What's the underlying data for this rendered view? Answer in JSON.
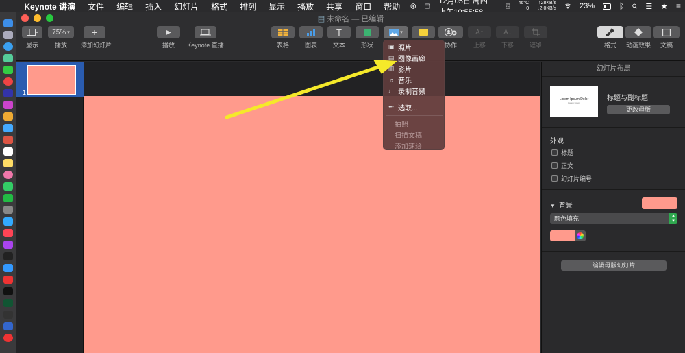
{
  "menubar": {
    "apple": "",
    "app_name": "Keynote 讲演",
    "items": [
      "文件",
      "编辑",
      "插入",
      "幻灯片",
      "格式",
      "排列",
      "显示",
      "播放",
      "共享",
      "窗口",
      "帮助"
    ],
    "status": {
      "temp": "46°C",
      "fan": "0",
      "net_up": "↑28KB/s",
      "net_down": "↓2.0KB/s",
      "datetime": "12月05日 周四 上午10:55:58",
      "battery": "23%"
    }
  },
  "window": {
    "title": "未命名 — 已编辑"
  },
  "toolbar": {
    "view": {
      "label": "显示",
      "icon": "sidebar-icon"
    },
    "zoom": {
      "label": "播放",
      "value": "75%"
    },
    "add_slide": {
      "label": "添加幻灯片",
      "glyph": "+"
    },
    "play": {
      "label": "播放",
      "glyph": "▶"
    },
    "keynote_live": {
      "label": "Keynote 直播"
    },
    "table": {
      "label": "表格"
    },
    "chart": {
      "label": "图表"
    },
    "text": {
      "label": "文本",
      "glyph": "T"
    },
    "shape": {
      "label": "形状"
    },
    "media": {
      "label": ""
    },
    "comment": {
      "label": ""
    },
    "collaborate": {
      "label": "协作"
    },
    "bring_forward": {
      "label": "上移",
      "glyph": "A↑"
    },
    "send_backward": {
      "label": "下移",
      "glyph": "A↓"
    },
    "mask": {
      "label": "遮罩"
    },
    "format": {
      "label": "格式"
    },
    "animate": {
      "label": "动画效果"
    },
    "document": {
      "label": "文稿"
    }
  },
  "navigator": {
    "slide_number": "1"
  },
  "media_menu": {
    "items": [
      {
        "label": "照片",
        "icon": "photo-icon",
        "enabled": true
      },
      {
        "label": "图像画廊",
        "icon": "image-gallery-icon",
        "enabled": true
      },
      {
        "label": "影片",
        "icon": "movie-icon",
        "enabled": true
      },
      {
        "label": "音乐",
        "icon": "music-icon",
        "enabled": true
      },
      {
        "label": "录制音频",
        "icon": "microphone-icon",
        "enabled": true
      }
    ],
    "choose": {
      "label": "选取...",
      "glyph": "•••"
    },
    "disabled_items": [
      "拍照",
      "扫描文稿",
      "添加速绘"
    ]
  },
  "inspector": {
    "title": "幻灯片布局",
    "layout_thumb_title": "Lorem Ipsum Dolor",
    "layout_thumb_sub": "Lorem Ipsum",
    "layout_name": "标题与副标题",
    "change_master": "更改母版",
    "appearance_title": "外观",
    "checkboxes": [
      "标题",
      "正文",
      "幻灯片编号"
    ],
    "background_title": "背景",
    "fill_type": "颜色填充",
    "edit_master": "编辑母版幻灯片"
  },
  "colors": {
    "slide_background": "#ff9a8c",
    "accent_blue": "#2a5cb0",
    "arrow_yellow": "#f5e92a"
  }
}
